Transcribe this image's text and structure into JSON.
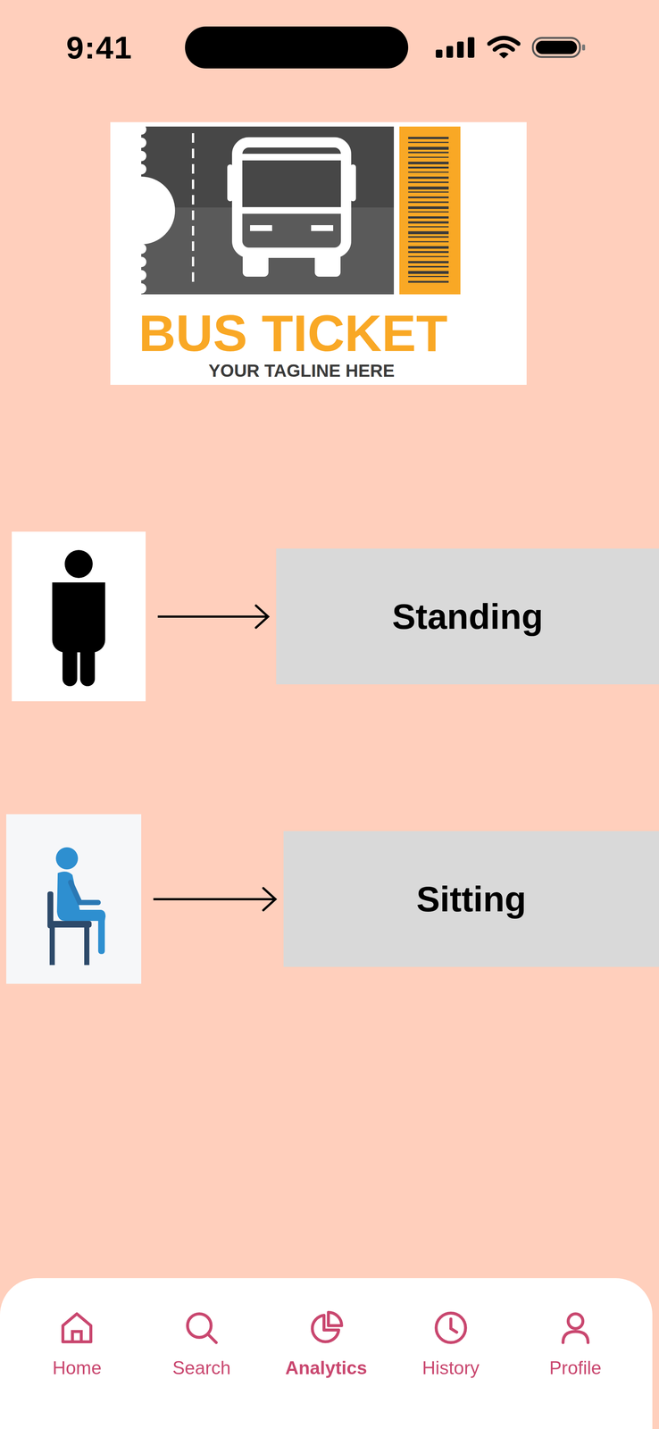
{
  "status_bar": {
    "time": "9:41"
  },
  "logo": {
    "title": "BUS TICKET",
    "tagline": "YOUR TAGLINE HERE"
  },
  "options": [
    {
      "label": "Standing",
      "kind": "standing"
    },
    {
      "label": "Sitting",
      "kind": "sitting"
    }
  ],
  "nav": [
    {
      "label": "Home",
      "selected": false
    },
    {
      "label": "Search",
      "selected": false
    },
    {
      "label": "Analytics",
      "selected": true
    },
    {
      "label": "History",
      "selected": false
    },
    {
      "label": "Profile",
      "selected": false
    }
  ]
}
